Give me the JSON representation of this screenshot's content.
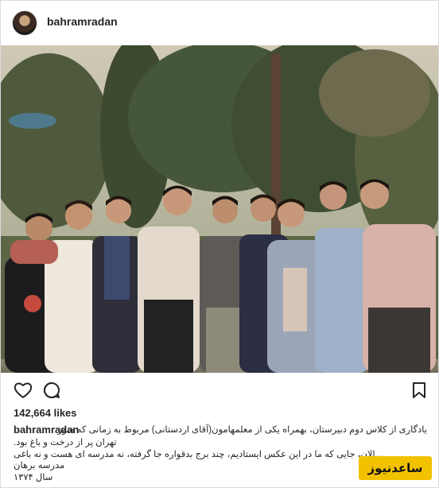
{
  "post": {
    "username": "bahramradan",
    "likes": "142,664 likes",
    "caption": {
      "username": "bahramradan",
      "line1": "یادگاری از کلاس دوم دبیرستان، بهمراه یکی از معلمهامون(آقای اردستانی) مربوط به زمانی که هنوز",
      "line2": "تهران پر از درخت و باغ بود.",
      "line3": "...الان، جایی که ما در این عکس ایستادیم، چند برج بدقواره جا گرفته، نه مدرسه ای هست و نه باغی",
      "line4": "مدرسه برهان",
      "line5": "سال ۱۳۷۴"
    },
    "watermark": "ساعدنیوز"
  },
  "icons": {
    "avatar": "profile-avatar",
    "like": "heart-icon",
    "comment": "comment-bubble-icon",
    "save": "bookmark-icon"
  },
  "colors": {
    "text": "#262626",
    "border": "#dbdbdb",
    "watermark_bg": "#f2c200"
  }
}
